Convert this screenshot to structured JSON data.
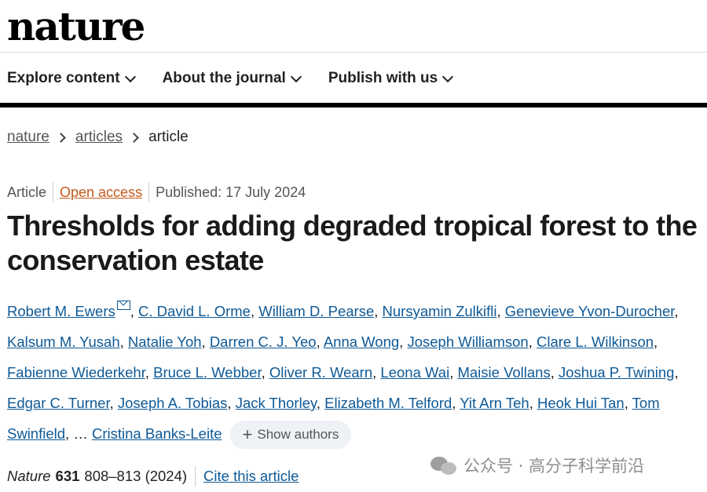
{
  "brand": {
    "logo_text": "nature"
  },
  "nav": {
    "items": [
      {
        "label": "Explore content"
      },
      {
        "label": "About the journal"
      },
      {
        "label": "Publish with us"
      }
    ]
  },
  "breadcrumb": {
    "items": [
      "nature",
      "articles"
    ],
    "current": "article"
  },
  "meta": {
    "type": "Article",
    "access": "Open access",
    "published": "Published: 17 July 2024"
  },
  "article": {
    "title": "Thresholds for adding degraded tropical forest to the conservation estate",
    "authors": [
      "Robert M. Ewers",
      "C. David L. Orme",
      "William D. Pearse",
      "Nursyamin Zulkifli",
      "Genevieve Yvon-Durocher",
      "Kalsum M. Yusah",
      "Natalie Yoh",
      "Darren C. J. Yeo",
      "Anna Wong",
      "Joseph Williamson",
      "Clare L. Wilkinson",
      "Fabienne Wiederkehr",
      "Bruce L. Webber",
      "Oliver R. Wearn",
      "Leona Wai",
      "Maisie Vollans",
      "Joshua P. Twining",
      "Edgar C. Turner",
      "Joseph A. Tobias",
      "Jack Thorley",
      "Elizabeth M. Telford",
      "Yit Arn Teh",
      "Heok Hui Tan",
      "Tom Swinfield"
    ],
    "ellipsis": "…",
    "last_author": "Cristina Banks-Leite",
    "show_authors": "Show authors"
  },
  "citation": {
    "journal": "Nature",
    "volume": "631",
    "pages": "808–813 (2024)",
    "cite_link": "Cite this article"
  },
  "watermark": {
    "text": "公众号 · 高分子科学前沿",
    "icon": "wechat-icon"
  },
  "colors": {
    "link": "#0e5996",
    "open_access": "#c45a1c",
    "text": "#222222"
  }
}
